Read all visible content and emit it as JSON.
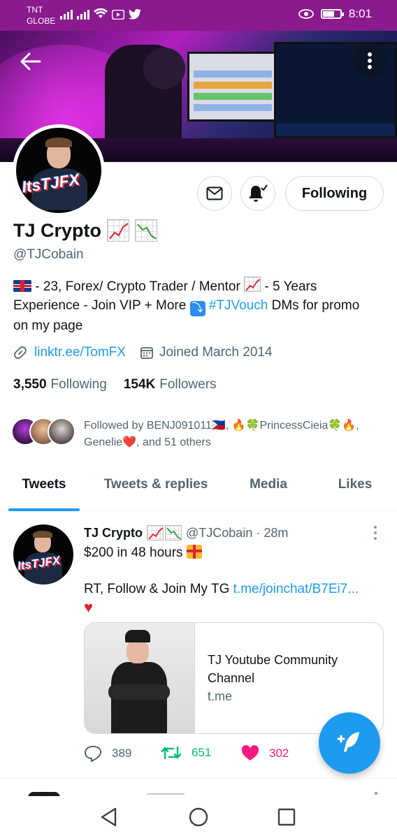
{
  "status_bar": {
    "carrier_line1": "TNT",
    "carrier_line2": "GLOBE",
    "time": "8:01",
    "color": "#8a1a8e"
  },
  "header": {
    "back_icon": "arrow-left-icon",
    "more_icon": "more-vertical-icon"
  },
  "profile": {
    "avatar_text": "ItsTJFX",
    "name": "TJ Crypto",
    "handle": "@TJCobain",
    "bio": {
      "part1": " - 23, Forex/ Crypto Trader / Mentor ",
      "part2": " - 5 Years Experience - Join VIP + More ",
      "hashtag": "#TJVouch",
      "part3": " DMs for promo on my page"
    },
    "website": "linktr.ee/TomFX",
    "joined": "Joined March 2014",
    "following_count": "3,550",
    "following_label": "Following",
    "followers_count": "154K",
    "followers_label": "Followers",
    "followed_by": "Followed by BENJ091011🇵🇭, 🔥🍀PrincessCieia🍀🔥, Genelie❤️, and 51 others"
  },
  "actions": {
    "message_icon": "mail-icon",
    "notify_icon": "bell-check-icon",
    "following_label": "Following"
  },
  "tabs": [
    {
      "label": "Tweets",
      "active": true
    },
    {
      "label": "Tweets & replies",
      "active": false
    },
    {
      "label": "Media",
      "active": false
    },
    {
      "label": "Likes",
      "active": false
    }
  ],
  "tweet": {
    "author_name": "TJ Crypto",
    "author_handle": "@TJCobain",
    "time": "· 28m",
    "line1": "$200 in 48 hours ",
    "line2_prefix": "RT, Follow & Join My TG ",
    "line2_link": "t.me/joinchat/B7Ei7...",
    "card": {
      "title": "TJ Youtube Community Channel",
      "domain": "t.me"
    },
    "reply_count": "389",
    "retweet_count": "651",
    "like_count": "302"
  },
  "colors": {
    "accent": "#1d9bf0",
    "retweet": "#00ba7c",
    "like": "#f91880",
    "secondary_text": "#536471"
  },
  "fab": {
    "icon": "compose-tweet-icon"
  },
  "nav": {
    "back_icon": "triangle-back-icon",
    "home_icon": "circle-home-icon",
    "recents_icon": "square-recents-icon"
  }
}
